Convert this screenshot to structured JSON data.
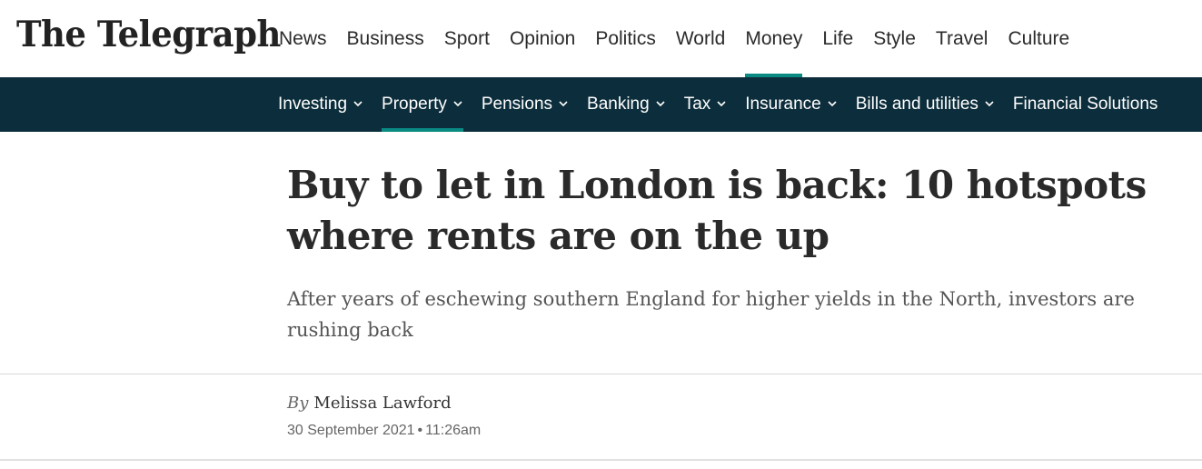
{
  "site": {
    "logo_text": "The Telegraph"
  },
  "primary_nav": {
    "items": [
      {
        "label": "News"
      },
      {
        "label": "Business"
      },
      {
        "label": "Sport"
      },
      {
        "label": "Opinion"
      },
      {
        "label": "Politics"
      },
      {
        "label": "World"
      },
      {
        "label": "Money"
      },
      {
        "label": "Life"
      },
      {
        "label": "Style"
      },
      {
        "label": "Travel"
      },
      {
        "label": "Culture"
      }
    ],
    "active": "Money"
  },
  "sub_nav": {
    "items": [
      {
        "label": "Investing",
        "icon": "chevron-down-icon"
      },
      {
        "label": "Property",
        "icon": "chevron-down-icon"
      },
      {
        "label": "Pensions",
        "icon": "chevron-down-icon"
      },
      {
        "label": "Banking",
        "icon": "chevron-down-icon"
      },
      {
        "label": "Tax",
        "icon": "chevron-down-icon"
      },
      {
        "label": "Insurance",
        "icon": "chevron-down-icon"
      },
      {
        "label": "Bills and utilities",
        "icon": "chevron-down-icon"
      },
      {
        "label": "Financial Solutions"
      }
    ],
    "active": "Property"
  },
  "article": {
    "headline": "Buy to let in London is back: 10 hotspots where rents are on the up",
    "standfirst": "After years of eschewing southern England for higher yields in the North, investors are rushing back",
    "byline_prefix": "By",
    "author": "Melissa Lawford",
    "date": "30 September 2021",
    "separator": "•",
    "time": "11:26am"
  },
  "colors": {
    "sub_nav_background": "#0c2d3b",
    "accent": "#0a8a82"
  }
}
